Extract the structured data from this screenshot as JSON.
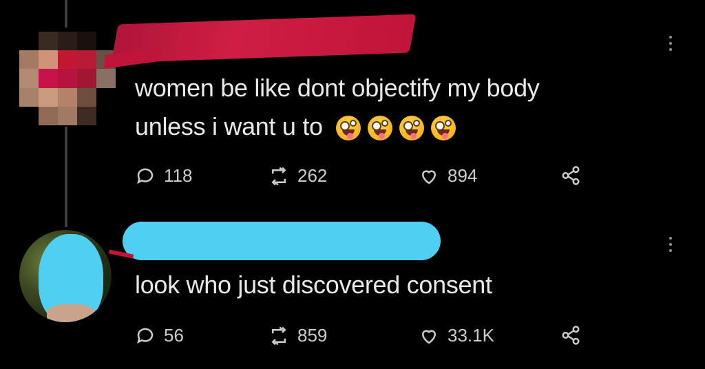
{
  "colors": {
    "background": "#000000",
    "text": "#e7e9ea",
    "meta": "#c9cdd1",
    "redact_red": "#d01d44",
    "redact_blue": "#4fd0f2"
  },
  "tweets": [
    {
      "text_line1": "women be like dont objectify my body",
      "text_line2": "unless i want u to",
      "emoji_count": 4,
      "emoji_name": "zany-face-emoji",
      "replies": "118",
      "retweets": "262",
      "likes": "894"
    },
    {
      "text_line1": "look who just discovered consent",
      "replies": "56",
      "retweets": "859",
      "likes": "33.1K"
    }
  ],
  "icons": {
    "reply": "speech-bubble-icon",
    "retweet": "retweet-icon",
    "like": "heart-icon",
    "share": "share-icon",
    "menu": "more-vertical-icon"
  }
}
